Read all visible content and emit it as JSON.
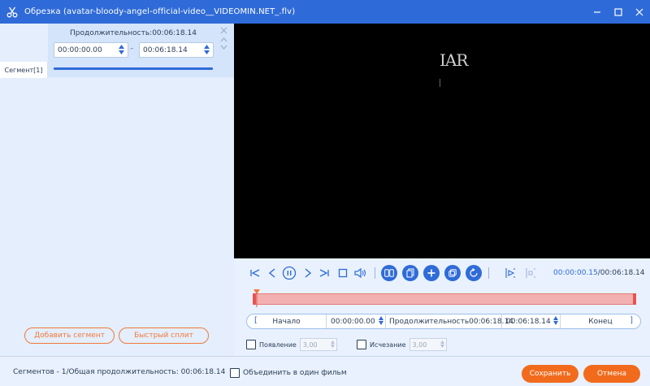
{
  "window": {
    "title": "Обрезка (avatar-bloody-angel-official-video__VIDEOMIN.NET_.flv)",
    "app_icon": "scissors-icon",
    "controls": [
      "minimize-icon",
      "maximize-icon",
      "close-icon"
    ]
  },
  "segment": {
    "duration_label": "Продолжительность:00:06:18.14",
    "start": "00:00:00.00",
    "end": "00:06:18.14",
    "tab_label": "Сегмент[1]"
  },
  "left_actions": {
    "add_segment": "Добавить сегмент",
    "quick_split": "Быстрый сплит"
  },
  "video": {
    "overlay_text": "IAR"
  },
  "playback": {
    "current_time": "00:00:00.15",
    "total_time": "/00:06:18.14"
  },
  "trim": {
    "start_label": "Начало",
    "start_value": "00:00:00.00",
    "duration_label": "Продолжительность",
    "duration_value": "00:06:18.14",
    "end_value": "00:06:18.14",
    "end_label": "Конец"
  },
  "fade": {
    "in_label": "Появление",
    "in_value": "3,00",
    "out_label": "Исчезание",
    "out_value": "3,00"
  },
  "footer": {
    "status": "Сегментов - 1/Общая продолжительность: 00:06:18.14",
    "merge_label": "Объединить в один фильм",
    "save": "Сохранить",
    "cancel": "Отмена"
  },
  "colors": {
    "accent": "#2f6bd8",
    "orange": "#f26b1d",
    "timeline": "#f2b1b0"
  }
}
